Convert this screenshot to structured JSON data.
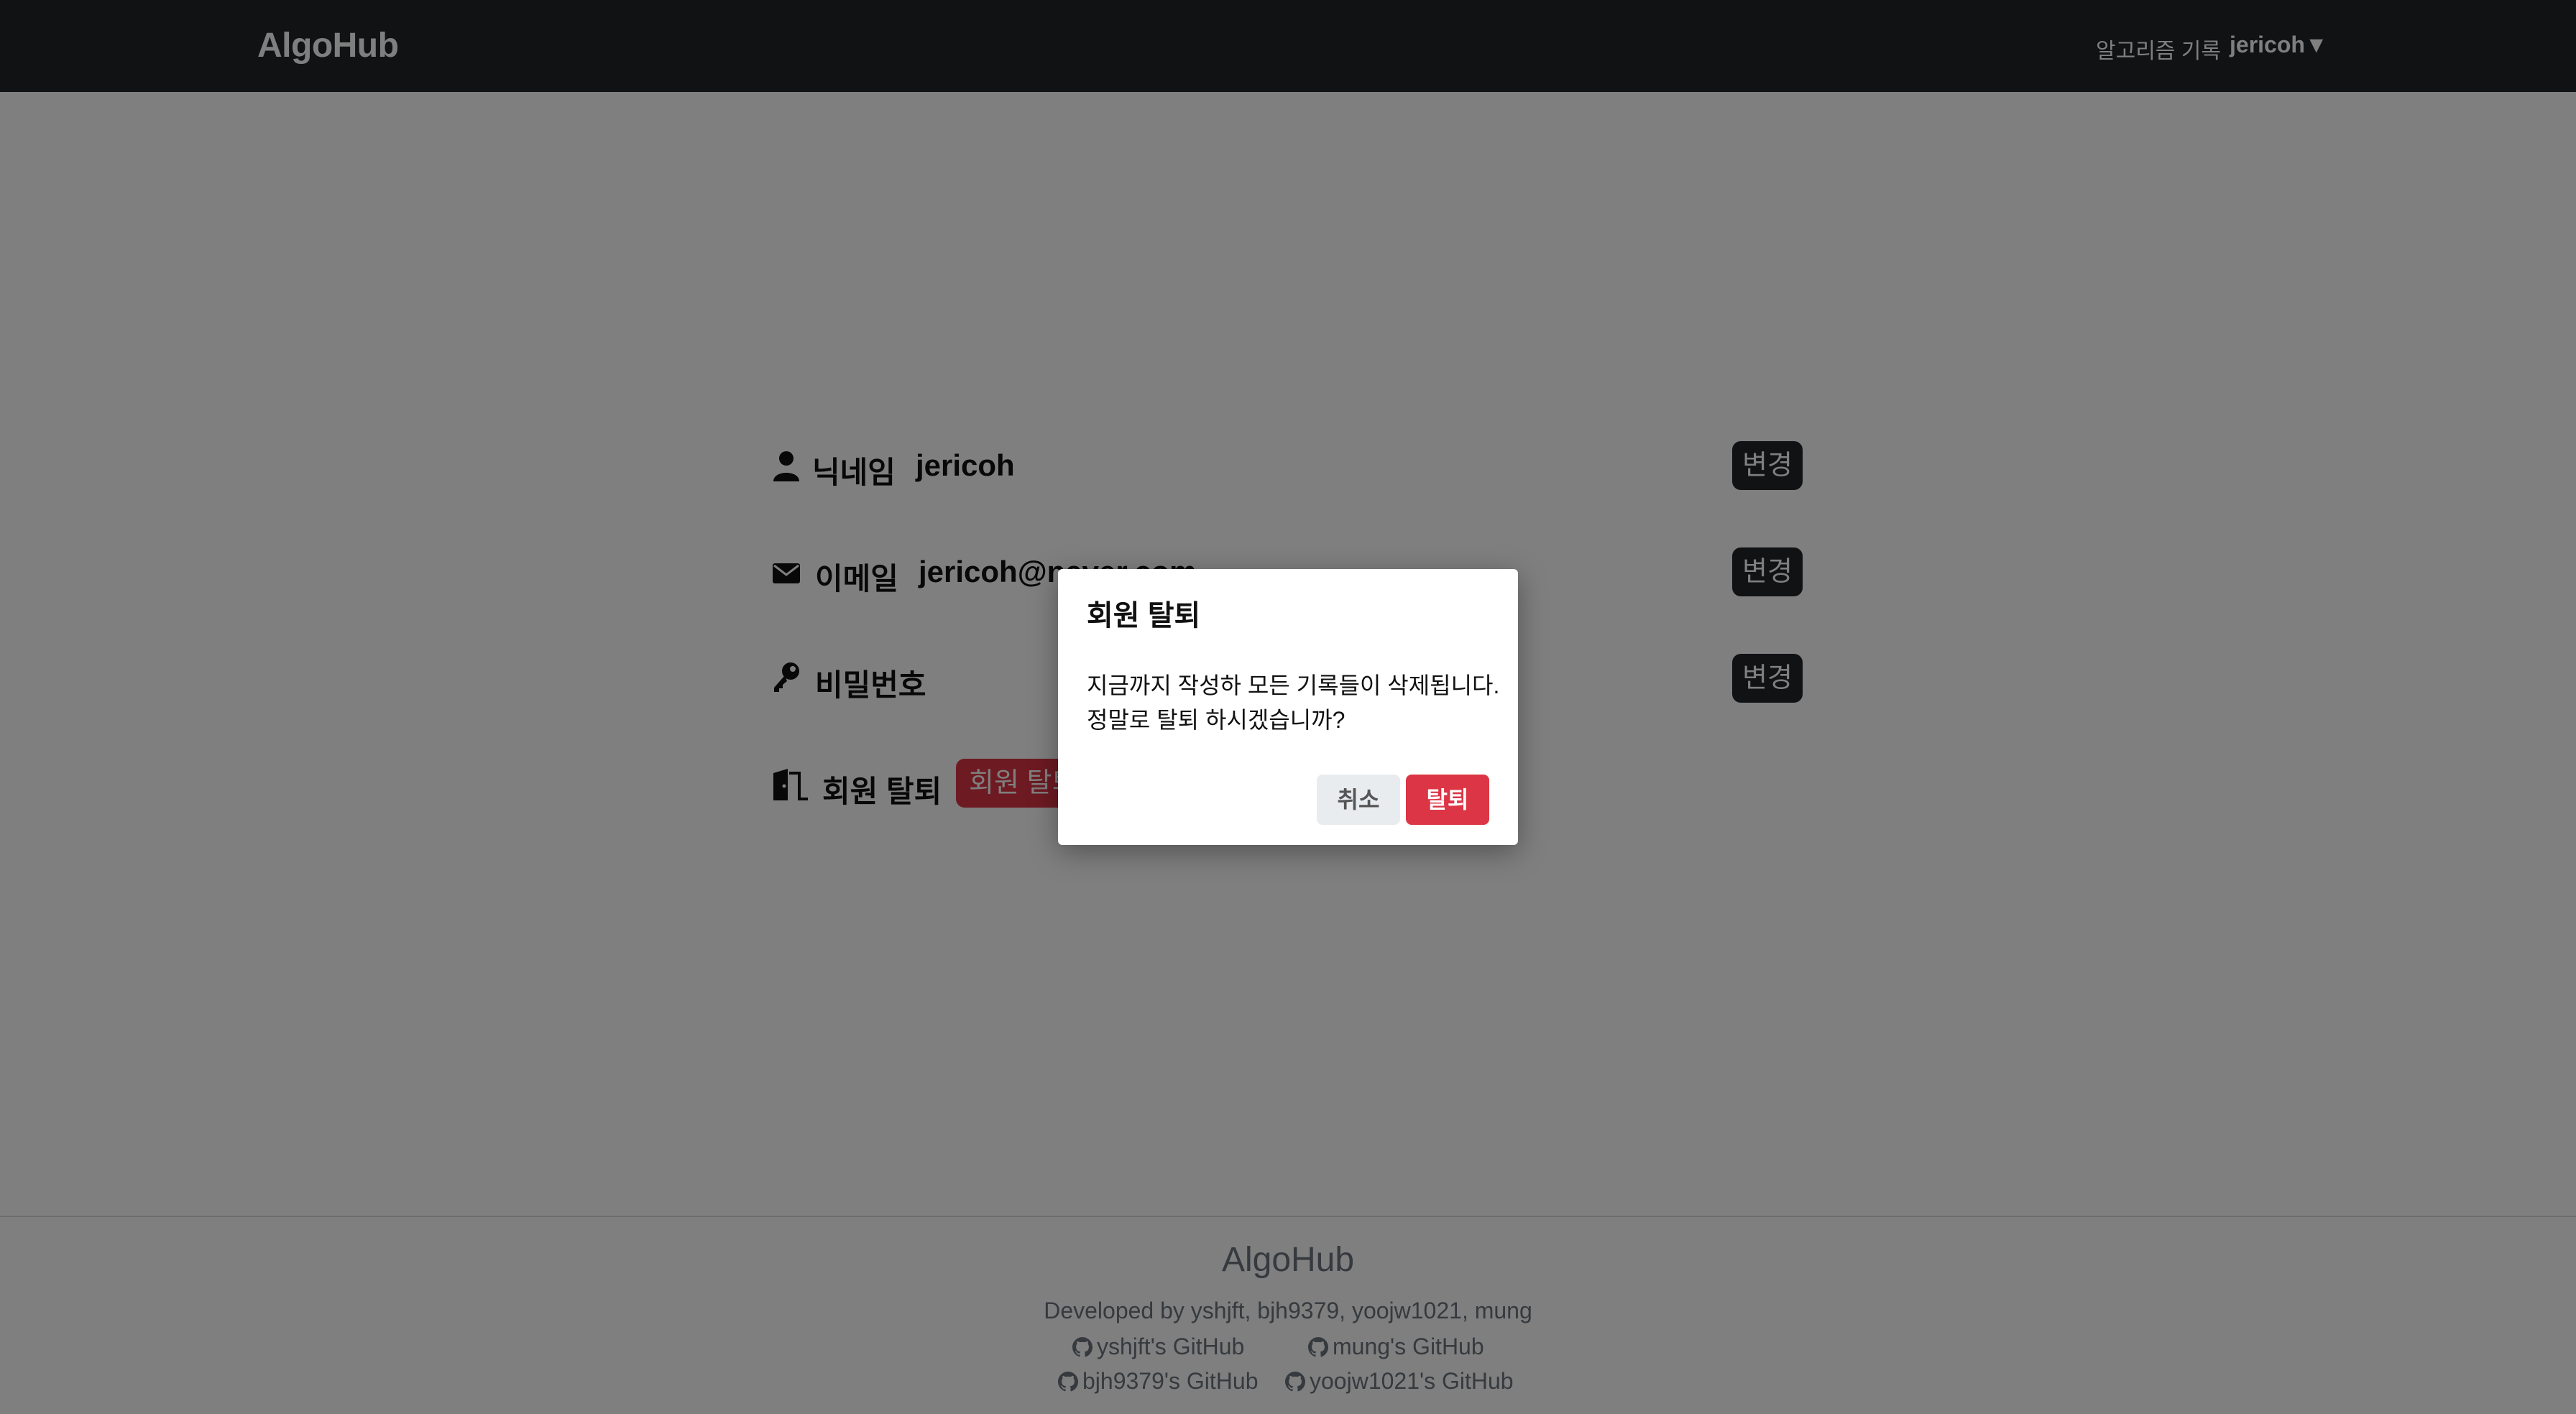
{
  "header": {
    "logo": "AlgoHub",
    "nav_records": "알고리즘 기록",
    "nav_user": "jericoh▼"
  },
  "profile": {
    "nickname": {
      "label": "닉네임",
      "value": "jericoh",
      "button": "변경",
      "icon": "user-icon"
    },
    "email": {
      "label": "이메일",
      "value": "jericoh@naver.com",
      "button": "변경",
      "icon": "envelope-icon"
    },
    "password": {
      "label": "비밀번호",
      "button": "변경",
      "icon": "key-icon"
    },
    "withdraw": {
      "label": "회원 탈퇴",
      "button": "회원 탈퇴",
      "icon": "door-exit-icon"
    }
  },
  "footer": {
    "title": "AlgoHub",
    "developers": "Developed by yshjft, bjh9379, yoojw1021, mung",
    "links": [
      "yshjft's GitHub",
      "mung's GitHub",
      "bjh9379's GitHub",
      "yoojw1021's GitHub"
    ]
  },
  "modal": {
    "title": "회원 탈퇴",
    "line1": "지금까지 작성하 모든 기록들이 삭제됩니다.",
    "line2": "정말로 탈퇴 하시겠습니까?",
    "cancel": "취소",
    "confirm": "탈퇴"
  },
  "colors": {
    "header_bg": "#212529",
    "danger": "#dc3545",
    "muted": "#6c757d"
  }
}
